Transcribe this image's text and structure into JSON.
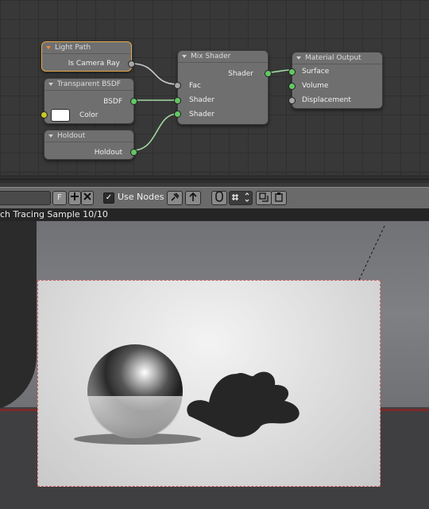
{
  "node_editor": {
    "nodes": {
      "light_path": {
        "title": "Light Path",
        "output": "Is Camera Ray"
      },
      "transparent": {
        "title": "Transparent BSDF",
        "output": "BSDF",
        "input": "Color"
      },
      "holdout": {
        "title": "Holdout",
        "output": "Holdout"
      },
      "mix": {
        "title": "Mix Shader",
        "output": "Shader",
        "inputs": [
          "Fac",
          "Shader",
          "Shader"
        ]
      },
      "material_output": {
        "title": "Material Output",
        "inputs": [
          "Surface",
          "Volume",
          "Displacement"
        ]
      }
    },
    "socket_colors": {
      "shader": "#63c763",
      "value": "#a6a6a6",
      "color": "#c7c729"
    }
  },
  "toolbar": {
    "fake_user_label": "F",
    "use_nodes_label": "Use Nodes",
    "use_nodes_checked": true
  },
  "viewport": {
    "status": "ch Tracing Sample 10/10"
  }
}
